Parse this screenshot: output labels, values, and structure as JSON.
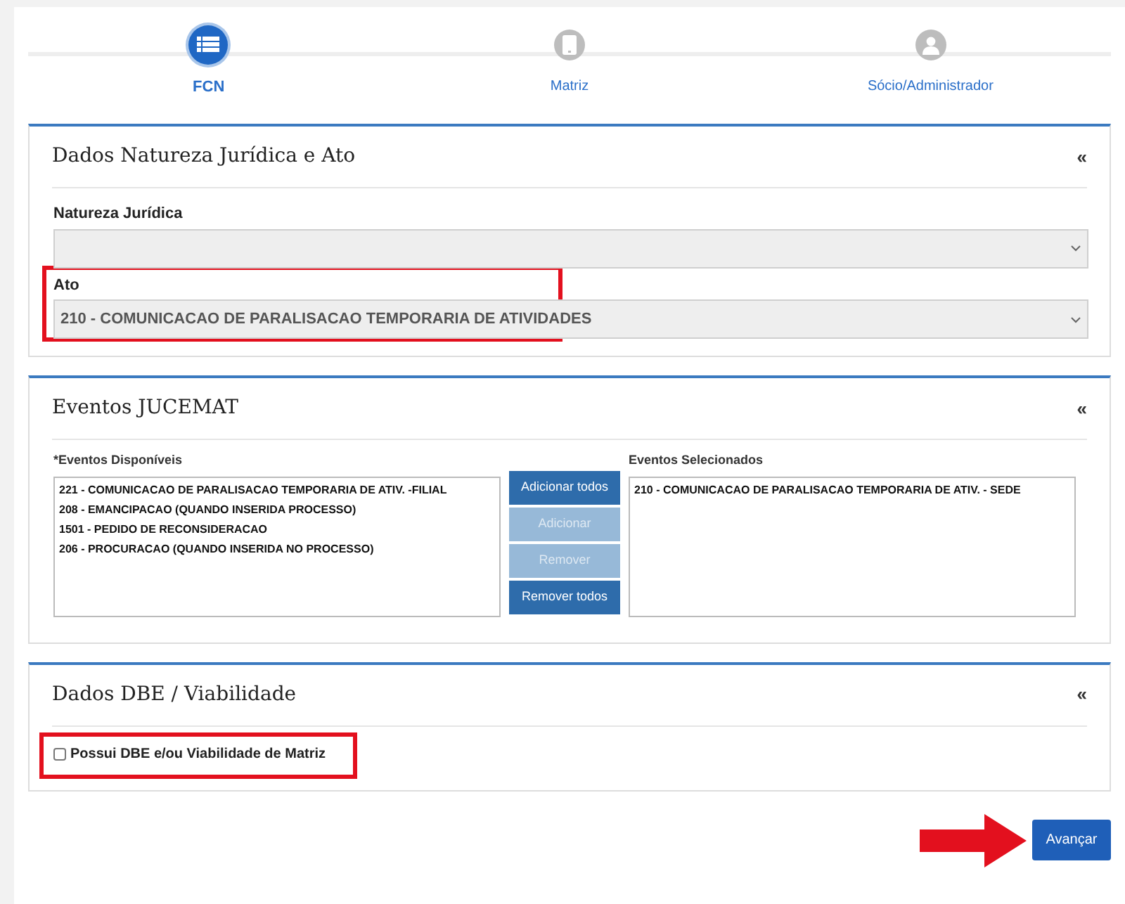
{
  "steps": [
    {
      "label": "FCN",
      "selected": true
    },
    {
      "label": "Matriz",
      "selected": false
    },
    {
      "label": "Sócio/Administrador",
      "selected": false
    }
  ],
  "panels": [
    {
      "kind": "selects",
      "title": "Dados Natureza Jurídica e Ato",
      "collapse": "«",
      "fields": [
        {
          "label": "Natureza Jurídica",
          "highlighted": false
        },
        {
          "label": "Ato",
          "value": "210 - COMUNICACAO DE PARALISACAO TEMPORARIA DE ATIVIDADES",
          "highlighted": true
        }
      ]
    },
    {
      "kind": "picker",
      "title": "Eventos JUCEMAT",
      "collapse": "«",
      "available_label": "*Eventos Disponíveis",
      "available": [
        "221 - COMUNICACAO DE PARALISACAO TEMPORARIA DE ATIV. -FILIAL",
        "208 - EMANCIPACAO (QUANDO INSERIDA PROCESSO)",
        "1501 - PEDIDO DE RECONSIDERACAO",
        "206 - PROCURACAO (QUANDO INSERIDA NO PROCESSO)"
      ],
      "buttons": [
        {
          "label": "Adicionar todos",
          "disabled": false
        },
        {
          "label": "Adicionar",
          "disabled": true
        },
        {
          "label": "Remover",
          "disabled": true
        },
        {
          "label": "Remover todos",
          "disabled": false
        }
      ],
      "selected_label": "Eventos Selecionados",
      "selected_items": [
        "210 - COMUNICACAO DE PARALISACAO TEMPORARIA DE ATIV. - SEDE"
      ]
    },
    {
      "kind": "checkbox",
      "title": "Dados DBE / Viabilidade",
      "collapse": "«",
      "label": "Possui DBE e/ou Viabilidade de Matriz",
      "checked": false,
      "highlighted": true
    }
  ],
  "next_button": {
    "label": "Avançar",
    "pointed": true
  }
}
